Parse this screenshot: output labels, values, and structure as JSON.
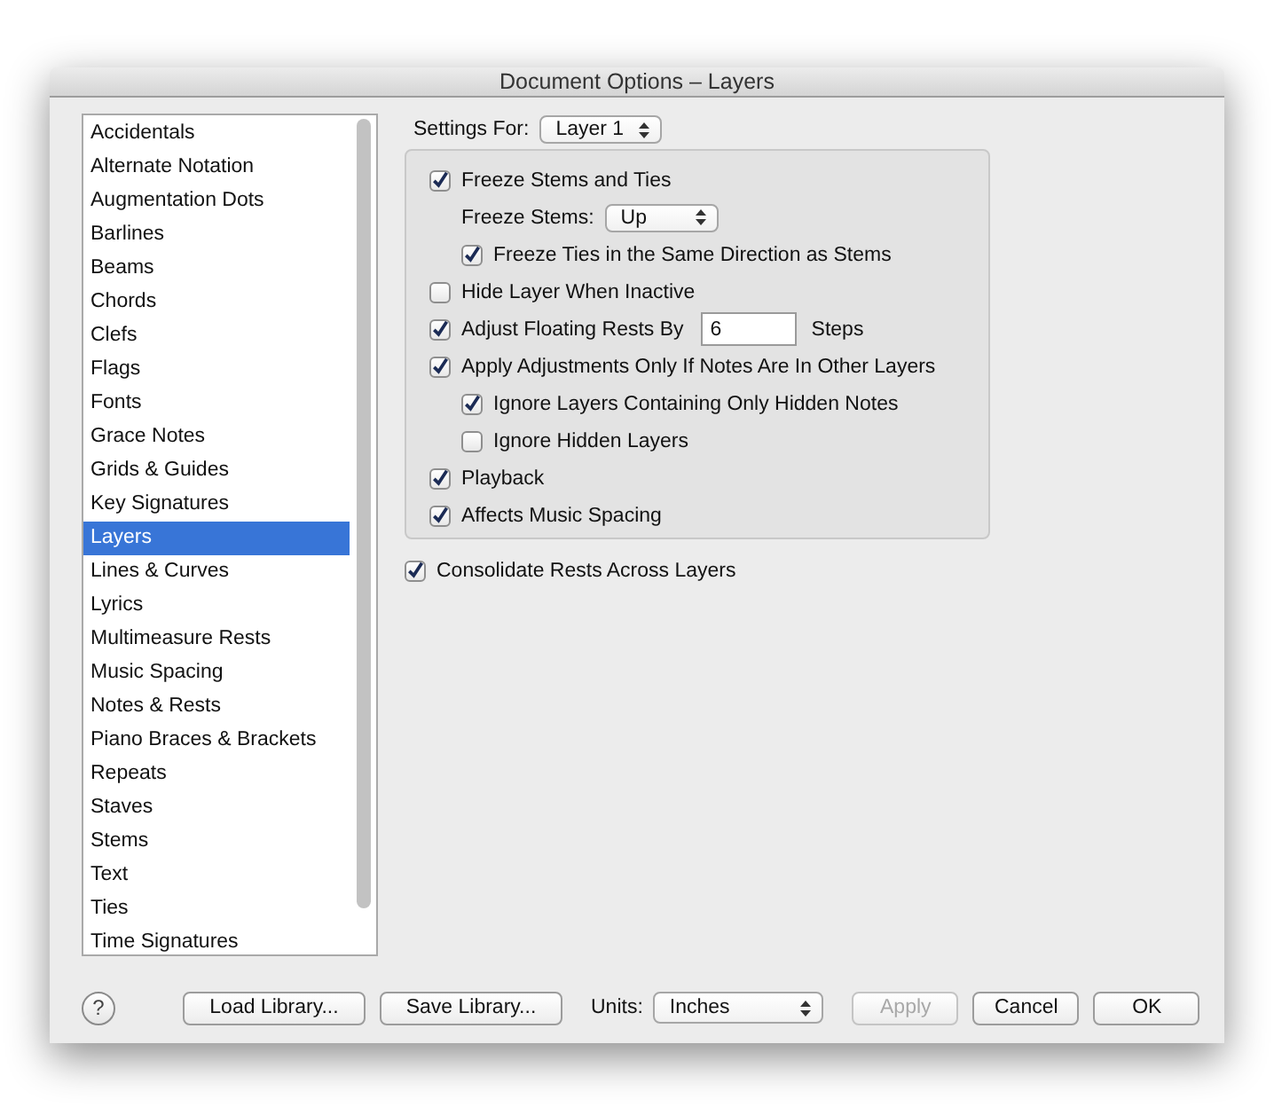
{
  "window": {
    "title": "Document Options – Layers"
  },
  "sidebar": {
    "items": [
      {
        "label": "Accidentals",
        "selected": false
      },
      {
        "label": "Alternate Notation",
        "selected": false
      },
      {
        "label": "Augmentation Dots",
        "selected": false
      },
      {
        "label": "Barlines",
        "selected": false
      },
      {
        "label": "Beams",
        "selected": false
      },
      {
        "label": "Chords",
        "selected": false
      },
      {
        "label": "Clefs",
        "selected": false
      },
      {
        "label": "Flags",
        "selected": false
      },
      {
        "label": "Fonts",
        "selected": false
      },
      {
        "label": "Grace Notes",
        "selected": false
      },
      {
        "label": "Grids & Guides",
        "selected": false
      },
      {
        "label": "Key Signatures",
        "selected": false
      },
      {
        "label": "Layers",
        "selected": true
      },
      {
        "label": "Lines & Curves",
        "selected": false
      },
      {
        "label": "Lyrics",
        "selected": false
      },
      {
        "label": "Multimeasure Rests",
        "selected": false
      },
      {
        "label": "Music Spacing",
        "selected": false
      },
      {
        "label": "Notes & Rests",
        "selected": false
      },
      {
        "label": "Piano Braces & Brackets",
        "selected": false
      },
      {
        "label": "Repeats",
        "selected": false
      },
      {
        "label": "Staves",
        "selected": false
      },
      {
        "label": "Stems",
        "selected": false
      },
      {
        "label": "Text",
        "selected": false
      },
      {
        "label": "Ties",
        "selected": false
      },
      {
        "label": "Time Signatures",
        "selected": false
      }
    ]
  },
  "settings_for": {
    "label": "Settings For:",
    "value": "Layer 1"
  },
  "options": [
    {
      "kind": "checkbox",
      "label": "Freeze Stems and Ties",
      "checked": true,
      "children": [
        {
          "kind": "select",
          "label": "Freeze Stems:",
          "value": "Up"
        },
        {
          "kind": "checkbox",
          "label": "Freeze Ties in the Same Direction as Stems",
          "checked": true
        }
      ]
    },
    {
      "kind": "checkbox",
      "label": "Hide Layer When Inactive",
      "checked": false
    },
    {
      "kind": "number",
      "label": "Adjust Floating Rests By",
      "checked": true,
      "value": "6",
      "suffix": "Steps"
    },
    {
      "kind": "checkbox",
      "label": "Apply Adjustments Only If Notes Are In Other Layers",
      "checked": true,
      "children": [
        {
          "kind": "checkbox",
          "label": "Ignore Layers Containing Only Hidden Notes",
          "checked": true
        },
        {
          "kind": "checkbox",
          "label": "Ignore Hidden Layers",
          "checked": false
        }
      ]
    },
    {
      "kind": "checkbox",
      "label": "Playback",
      "checked": true
    },
    {
      "kind": "checkbox",
      "label": "Affects Music Spacing",
      "checked": true
    }
  ],
  "consolidate": {
    "label": "Consolidate Rests Across Layers",
    "checked": true
  },
  "footer": {
    "help": "?",
    "load": "Load Library...",
    "save": "Save Library...",
    "units_label": "Units:",
    "units": "Inches",
    "buttons": [
      {
        "label": "Apply",
        "disabled": true
      },
      {
        "label": "Cancel",
        "disabled": false
      },
      {
        "label": "OK",
        "disabled": false
      }
    ]
  }
}
